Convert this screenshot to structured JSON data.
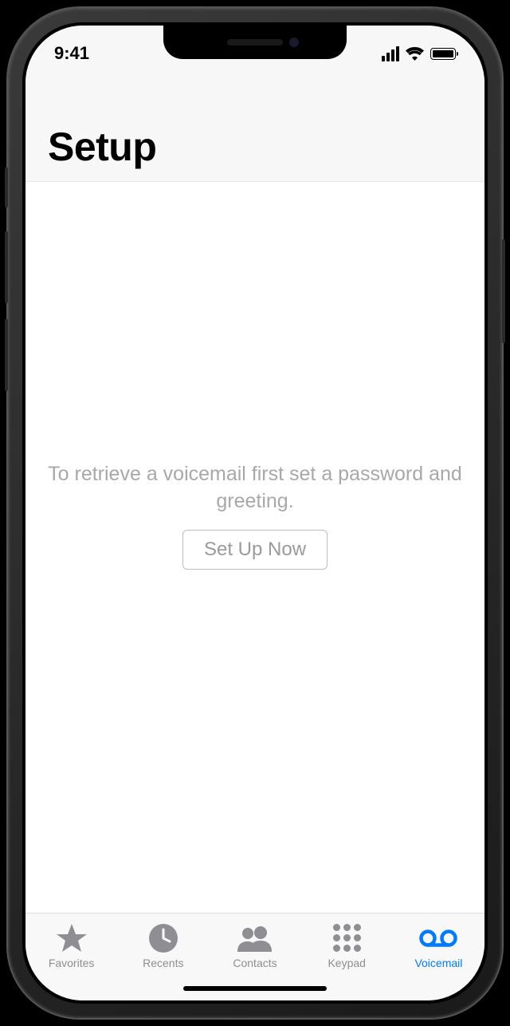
{
  "status": {
    "time": "9:41"
  },
  "header": {
    "title": "Setup"
  },
  "main": {
    "message": "To retrieve a voicemail first set a password and greeting.",
    "button_label": "Set Up Now"
  },
  "tabbar": {
    "items": [
      {
        "label": "Favorites",
        "icon": "star-icon",
        "active": false
      },
      {
        "label": "Recents",
        "icon": "clock-icon",
        "active": false
      },
      {
        "label": "Contacts",
        "icon": "contacts-icon",
        "active": false
      },
      {
        "label": "Keypad",
        "icon": "keypad-icon",
        "active": false
      },
      {
        "label": "Voicemail",
        "icon": "voicemail-icon",
        "active": true
      }
    ]
  },
  "colors": {
    "accent": "#007aff",
    "inactive": "#8e8e93",
    "header_bg": "#f7f7f7",
    "tabbar_bg": "#f8f8f8"
  }
}
